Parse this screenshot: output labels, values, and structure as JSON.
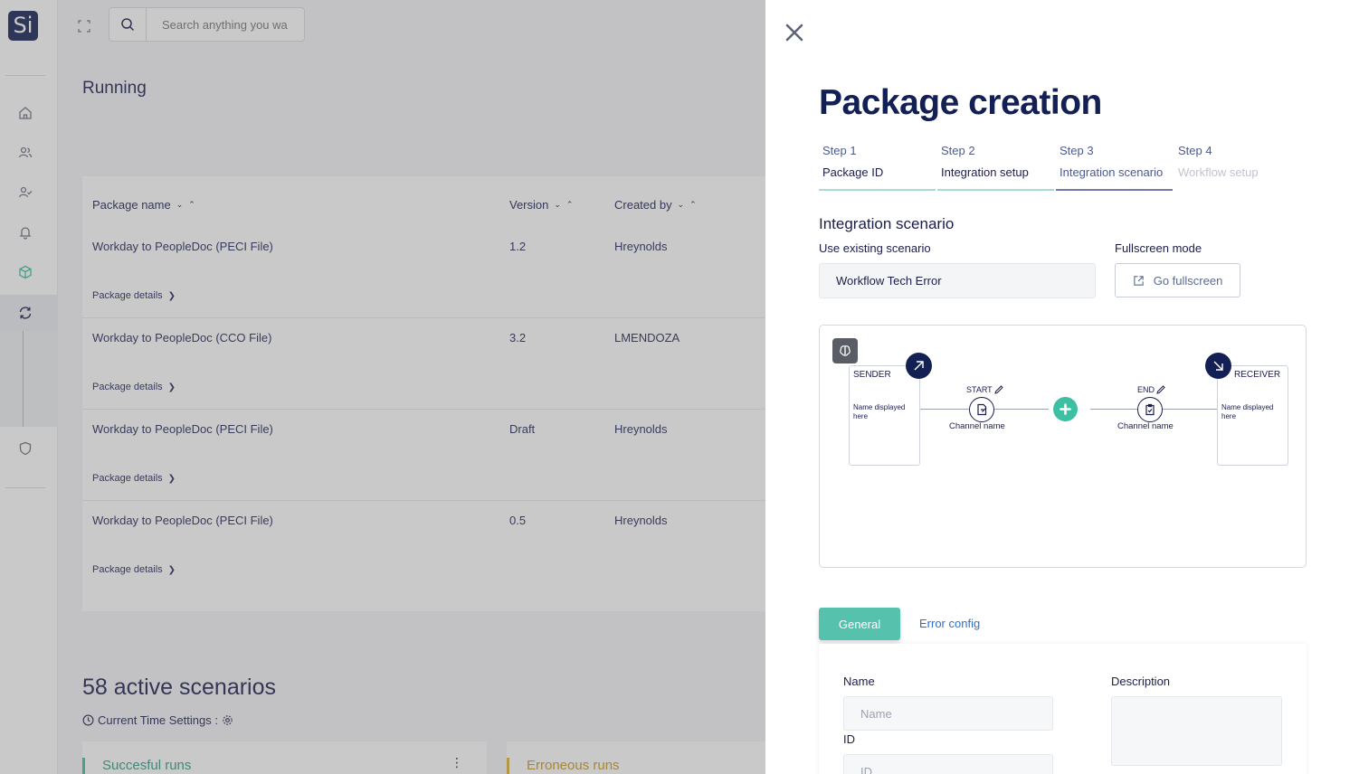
{
  "app": {
    "logo_text": "Si"
  },
  "search": {
    "placeholder": "Search anything you wa"
  },
  "main": {
    "title": "Running",
    "table": {
      "columns": {
        "package_name": "Package name",
        "version": "Version",
        "created_by": "Created by"
      },
      "rows": [
        {
          "name": "Workday to PeopleDoc (PECI File)",
          "version": "1.2",
          "created_by": "Hreynolds",
          "details": "Package details"
        },
        {
          "name": "Workday to PeopleDoc (CCO File)",
          "version": "3.2",
          "created_by": "LMENDOZA",
          "details": "Package details"
        },
        {
          "name": "Workday to PeopleDoc (PECI File)",
          "version": "Draft",
          "created_by": "Hreynolds",
          "details": "Package details"
        },
        {
          "name": "Workday to PeopleDoc (PECI File)",
          "version": "0.5",
          "created_by": "Hreynolds",
          "details": "Package details"
        }
      ]
    },
    "active_title": "58 active scenarios",
    "time_settings": "Current Time Settings :",
    "cards": {
      "success": "Succesful runs",
      "error": "Erroneous runs"
    }
  },
  "drawer": {
    "title": "Package creation",
    "steps": [
      {
        "num": "Step 1",
        "name": "Package ID"
      },
      {
        "num": "Step 2",
        "name": "Integration setup"
      },
      {
        "num": "Step 3",
        "name": "Integration scenario"
      },
      {
        "num": "Step 4",
        "name": "Workflow setup"
      }
    ],
    "section_title": "Integration scenario",
    "existing_label": "Use existing scenario",
    "existing_value": "Workflow Tech Error",
    "fullscreen_label": "Fullscreen mode",
    "fullscreen_button": "Go fullscreen",
    "diagram": {
      "sender": {
        "title": "SENDER",
        "desc": "Name displayed here"
      },
      "receiver": {
        "title": "RECEIVER",
        "desc": "Name displayed here"
      },
      "start": {
        "label": "START",
        "channel": "Channel name"
      },
      "end": {
        "label": "END",
        "channel": "Channel name"
      }
    },
    "tabs": {
      "general": "General",
      "error": "Error config"
    },
    "form": {
      "name_label": "Name",
      "name_placeholder": "Name",
      "id_label": "ID",
      "id_placeholder": "ID",
      "description_label": "Description"
    }
  },
  "colors": {
    "navy": "#132054",
    "teal": "#56c1ad",
    "success_bar": "#3dbfa4",
    "error_bar": "#e0b33a"
  }
}
